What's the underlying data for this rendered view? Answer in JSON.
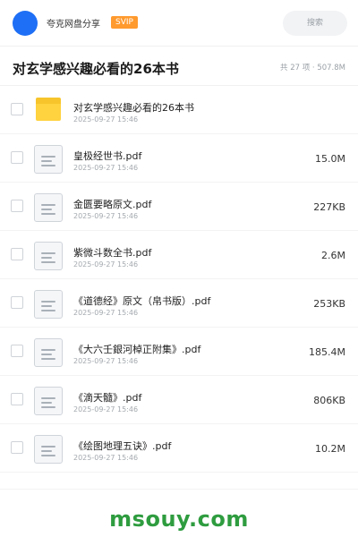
{
  "header": {
    "owner_name": "夸克网盘分享",
    "badge": "SVIP",
    "search_placeholder": "搜索"
  },
  "folder": {
    "title": "对玄学感兴趣必看的26本书",
    "summary": "共 27 项 · 507.8M"
  },
  "items": [
    {
      "name": "对玄学感兴趣必看的26本书",
      "date": "2025-09-27 15:46",
      "size": "",
      "icon": "folder-icon"
    },
    {
      "name": "皇极经世书.pdf",
      "date": "2025-09-27 15:46",
      "size": "15.0M",
      "icon": "document-icon"
    },
    {
      "name": "金匮要略原文.pdf",
      "date": "2025-09-27 15:46",
      "size": "227KB",
      "icon": "document-icon"
    },
    {
      "name": "紫微斗数全书.pdf",
      "date": "2025-09-27 15:46",
      "size": "2.6M",
      "icon": "document-icon"
    },
    {
      "name": "《道德经》原文（帛书版）.pdf",
      "date": "2025-09-27 15:46",
      "size": "253KB",
      "icon": "document-icon"
    },
    {
      "name": "《大六壬銀河棹正附集》.pdf",
      "date": "2025-09-27 15:46",
      "size": "185.4M",
      "icon": "document-icon"
    },
    {
      "name": "《滴天髓》.pdf",
      "date": "2025-09-27 15:46",
      "size": "806KB",
      "icon": "document-icon"
    },
    {
      "name": "《绘图地理五诀》.pdf",
      "date": "2025-09-27 15:46",
      "size": "10.2M",
      "icon": "document-icon"
    }
  ],
  "watermark": "msouy.com",
  "colors": {
    "accent": "#1e6ff5",
    "badge": "#ff9a2e",
    "folder": "#ffd23f",
    "watermark": "#2e9c3f"
  }
}
